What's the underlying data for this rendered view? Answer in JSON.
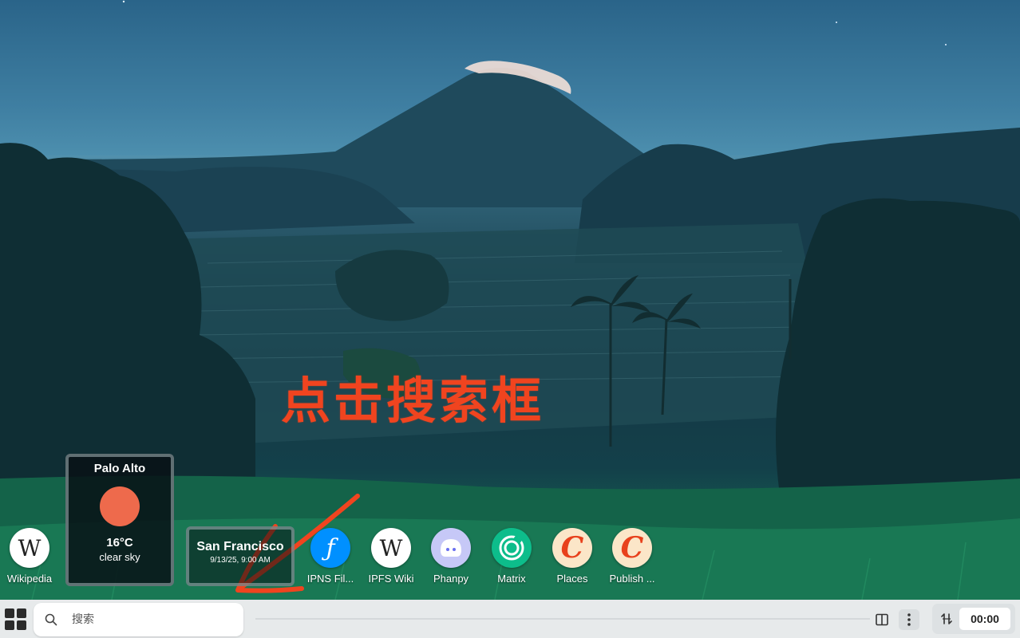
{
  "annotation": {
    "text": "点击搜索框",
    "color": "#f0441f"
  },
  "shortcuts": [
    {
      "label": "Wikipedia",
      "icon": "wikipedia-icon"
    },
    {
      "label": "IPNS Fil...",
      "icon": "filecoin-icon"
    },
    {
      "label": "IPFS Wiki",
      "icon": "wikipedia-icon"
    },
    {
      "label": "Phanpy",
      "icon": "phanpy-icon"
    },
    {
      "label": "Matrix",
      "icon": "matrix-icon"
    },
    {
      "label": "Places",
      "icon": "c-letter-icon"
    },
    {
      "label": "Publish ...",
      "icon": "c-letter-icon"
    }
  ],
  "icon_glyphs": {
    "wiki": "W",
    "fil": "ƒ",
    "c": "C"
  },
  "weather": {
    "city": "Palo Alto",
    "temperature": "16°C",
    "description": "clear sky"
  },
  "clock_widget": {
    "city": "San Francisco",
    "datetime": "9/13/25, 9:00 AM"
  },
  "taskbar": {
    "search_placeholder": "搜索",
    "time": "00:00"
  },
  "colors": {
    "accent_red": "#f0441f",
    "taskbar_bg": "#e7eaeb",
    "weather_sun": "#ee6a4c"
  }
}
